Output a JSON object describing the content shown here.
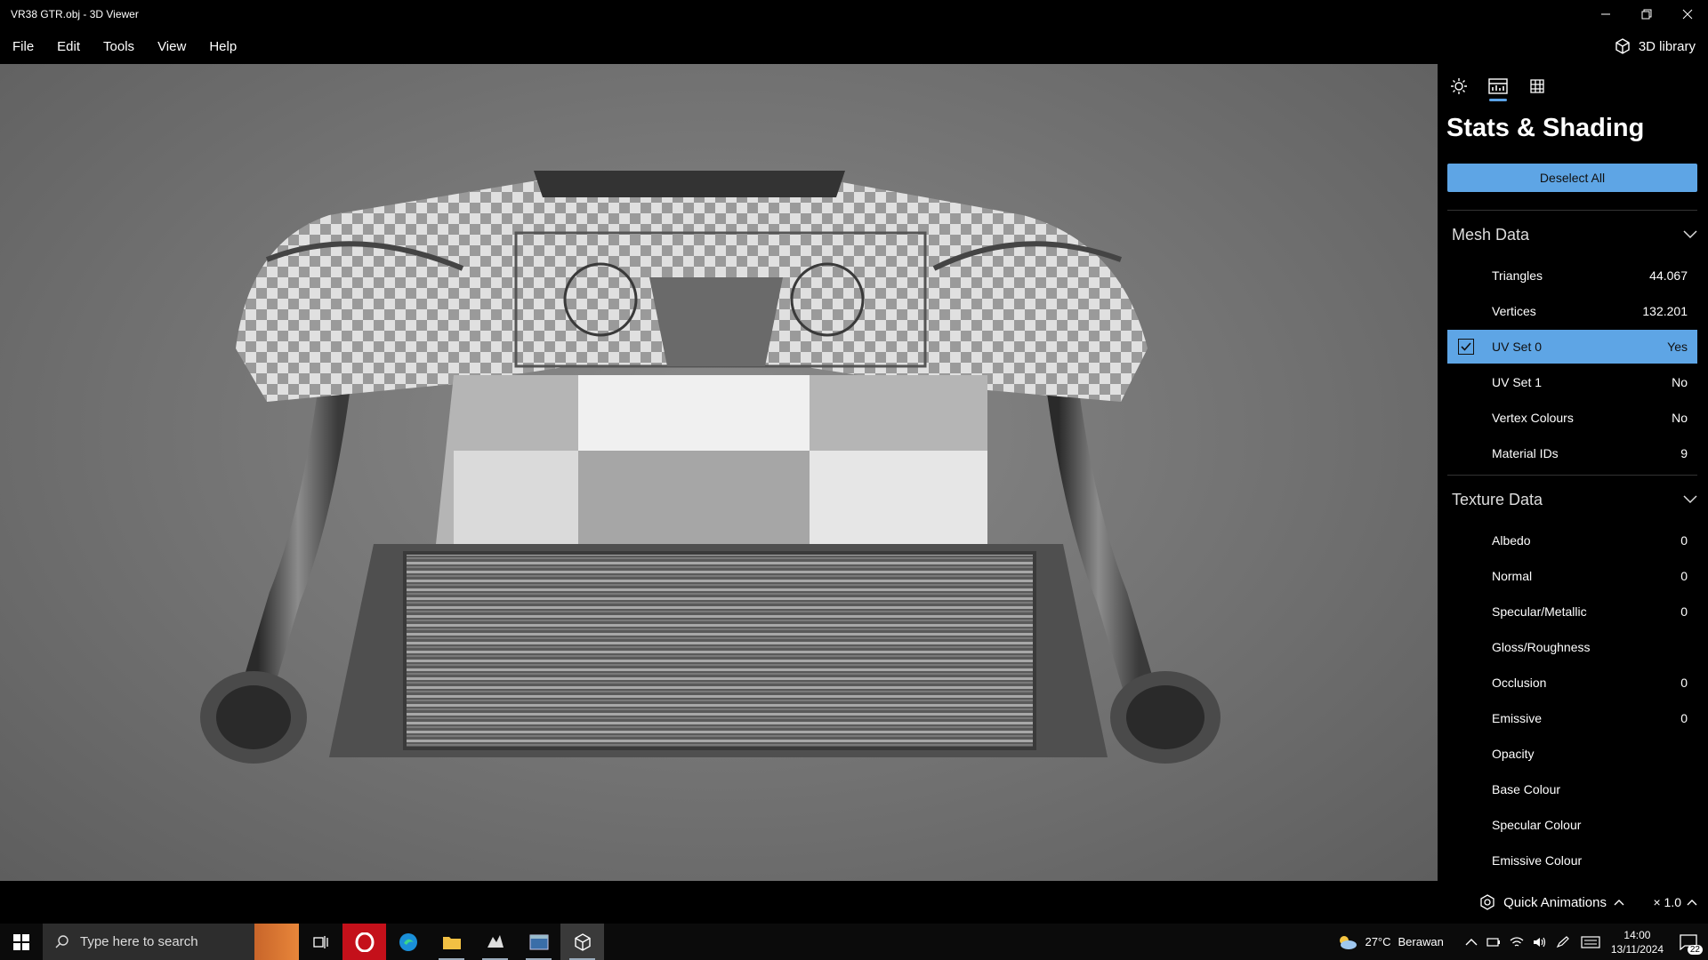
{
  "window": {
    "title": "VR38 GTR.obj - 3D Viewer"
  },
  "menu": [
    "File",
    "Edit",
    "Tools",
    "View",
    "Help"
  ],
  "library_button": "3D library",
  "panel": {
    "title": "Stats & Shading",
    "deselect_label": "Deselect All",
    "mesh_section": "Mesh Data",
    "mesh_rows": [
      {
        "label": "Triangles",
        "value": "44.067"
      },
      {
        "label": "Vertices",
        "value": "132.201"
      },
      {
        "label": "UV Set 0",
        "value": "Yes"
      },
      {
        "label": "UV Set 1",
        "value": "No"
      },
      {
        "label": "Vertex Colours",
        "value": "No"
      },
      {
        "label": "Material IDs",
        "value": "9"
      }
    ],
    "texture_section": "Texture Data",
    "texture_rows": [
      {
        "label": "Albedo",
        "value": "0"
      },
      {
        "label": "Normal",
        "value": "0"
      },
      {
        "label": "Specular/Metallic",
        "value": "0"
      },
      {
        "label": "Gloss/Roughness",
        "value": ""
      },
      {
        "label": "Occlusion",
        "value": "0"
      },
      {
        "label": "Emissive",
        "value": "0"
      },
      {
        "label": "Opacity",
        "value": ""
      },
      {
        "label": "Base Colour",
        "value": ""
      },
      {
        "label": "Specular Colour",
        "value": ""
      },
      {
        "label": "Emissive Colour",
        "value": ""
      }
    ]
  },
  "statusbar": {
    "quick_animations": "Quick Animations",
    "speed": "× 1.0"
  },
  "taskbar": {
    "search_placeholder": "Type here to search",
    "weather_temp": "27°C",
    "weather_desc": "Berawan",
    "time": "14:00",
    "date": "13/11/2024",
    "notification_count": "22"
  },
  "colors": {
    "accent": "#5ea5e5",
    "viewport_bg": "#757575",
    "panel_bg": "#000000"
  }
}
